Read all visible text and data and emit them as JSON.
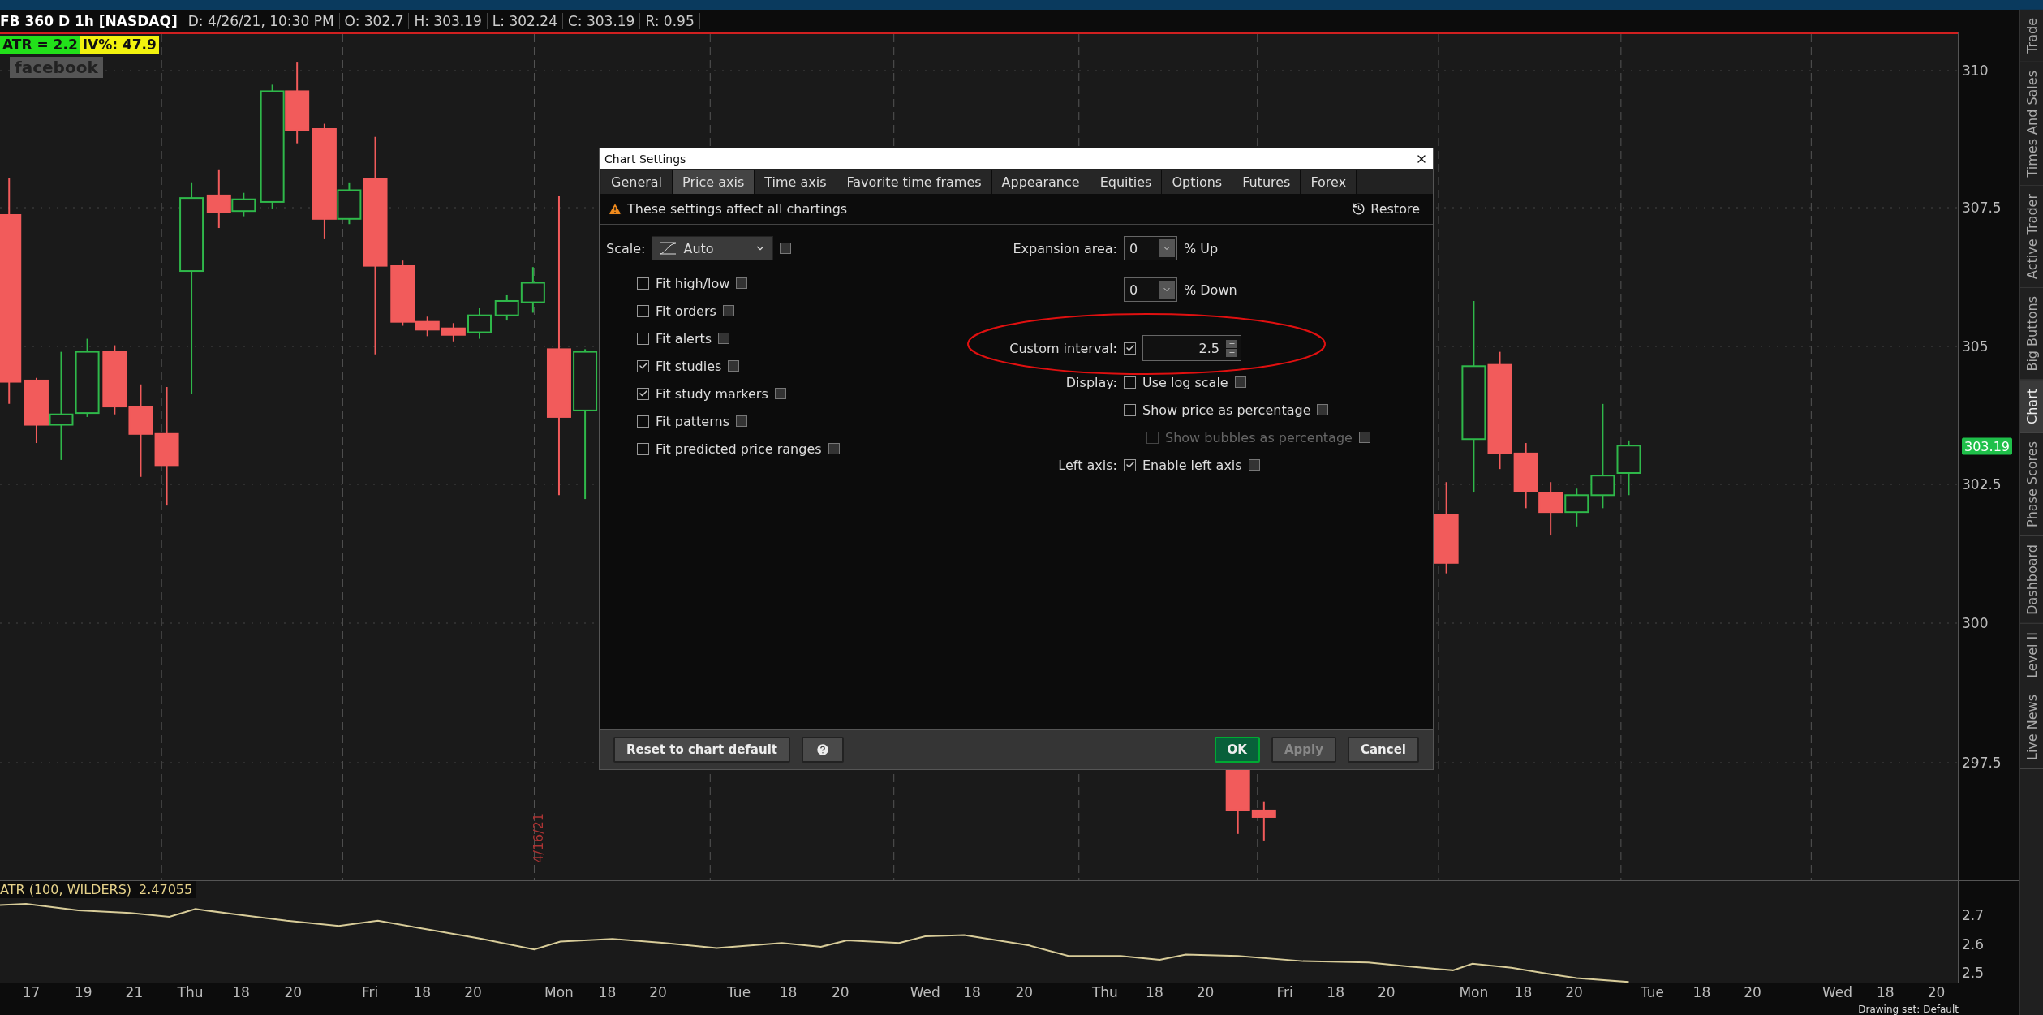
{
  "header": {
    "symbol": "FB 360 D 1h [NASDAQ]",
    "fields": [
      "D: 4/26/21, 10:30 PM",
      "O: 302.7",
      "H: 303.19",
      "L: 302.24",
      "C: 303.19",
      "R: 0.95"
    ]
  },
  "labels": [
    {
      "text": "ATR = 2.2",
      "color": "#22e01a"
    },
    {
      "text": "IV%: 47.9",
      "color": "#f2f20e"
    }
  ],
  "description": "facebook",
  "date_marker": "4/16/21",
  "price_axis": {
    "ticks": [
      "310",
      "307.5",
      "305",
      "302.5",
      "300",
      "297.5"
    ],
    "last_price": "303.19"
  },
  "study": {
    "title": "ATR (100, WILDERS)",
    "value": "2.47055",
    "ticks": [
      "2.7",
      "2.6",
      "2.5"
    ]
  },
  "time_axis": [
    "17",
    "19",
    "21",
    "Thu",
    "18",
    "20",
    "Fri",
    "18",
    "20",
    "Mon",
    "18",
    "20",
    "Tue",
    "18",
    "20",
    "Wed",
    "18",
    "20",
    "Thu",
    "18",
    "20",
    "Fri",
    "18",
    "20",
    "Mon",
    "18",
    "20",
    "Tue",
    "18",
    "20",
    "Wed",
    "18",
    "20"
  ],
  "status_bar": {
    "drawing_set": "Drawing set: Default"
  },
  "sidebar": [
    {
      "label": "Trade",
      "selected": false
    },
    {
      "label": "Times And Sales",
      "selected": false
    },
    {
      "label": "Active Trader",
      "selected": false
    },
    {
      "label": "Big Buttons",
      "selected": false
    },
    {
      "label": "Chart",
      "selected": true
    },
    {
      "label": "Phase Scores",
      "selected": false
    },
    {
      "label": "Dashboard",
      "selected": false
    },
    {
      "label": "Level II",
      "selected": false
    },
    {
      "label": "Live News",
      "selected": false
    }
  ],
  "dialog": {
    "title": "Chart Settings",
    "tabs": [
      {
        "label": "General",
        "selected": false
      },
      {
        "label": "Price axis",
        "selected": true
      },
      {
        "label": "Time axis",
        "selected": false
      },
      {
        "label": "Favorite time frames",
        "selected": false
      },
      {
        "label": "Appearance",
        "selected": false
      },
      {
        "label": "Equities",
        "selected": false
      },
      {
        "label": "Options",
        "selected": false
      },
      {
        "label": "Futures",
        "selected": false
      },
      {
        "label": "Forex",
        "selected": false
      }
    ],
    "warning": "These settings affect all chartings",
    "restore": "Restore",
    "scale": {
      "label": "Scale:",
      "value": "Auto"
    },
    "fit_options": [
      {
        "label": "Fit high/low",
        "checked": false
      },
      {
        "label": "Fit orders",
        "checked": false
      },
      {
        "label": "Fit alerts",
        "checked": false
      },
      {
        "label": "Fit studies",
        "checked": true
      },
      {
        "label": "Fit study markers",
        "checked": true
      },
      {
        "label": "Fit patterns",
        "checked": false
      },
      {
        "label": "Fit predicted price ranges",
        "checked": false
      }
    ],
    "expansion": {
      "label": "Expansion area:",
      "fields": [
        {
          "value": "0",
          "unit": "% Up"
        },
        {
          "value": "0",
          "unit": "% Down"
        }
      ]
    },
    "custom_interval": {
      "label": "Custom interval:",
      "checked": true,
      "value": "2.5"
    },
    "display": {
      "label": "Display:",
      "options": [
        {
          "label": "Use log scale",
          "checked": false,
          "disabled": false
        },
        {
          "label": "Show price as percentage",
          "checked": false,
          "disabled": false
        },
        {
          "label": "Show bubbles as percentage",
          "checked": false,
          "disabled": true
        }
      ]
    },
    "left_axis": {
      "label": "Left axis:",
      "option": {
        "label": "Enable left axis",
        "checked": true
      }
    },
    "buttons": [
      {
        "label": "Reset to chart default",
        "kind": "plain",
        "disabled": false
      },
      {
        "label": "OK",
        "kind": "primary",
        "disabled": false
      },
      {
        "label": "Apply",
        "kind": "plain",
        "disabled": true
      },
      {
        "label": "Cancel",
        "kind": "plain",
        "disabled": false
      }
    ]
  }
}
